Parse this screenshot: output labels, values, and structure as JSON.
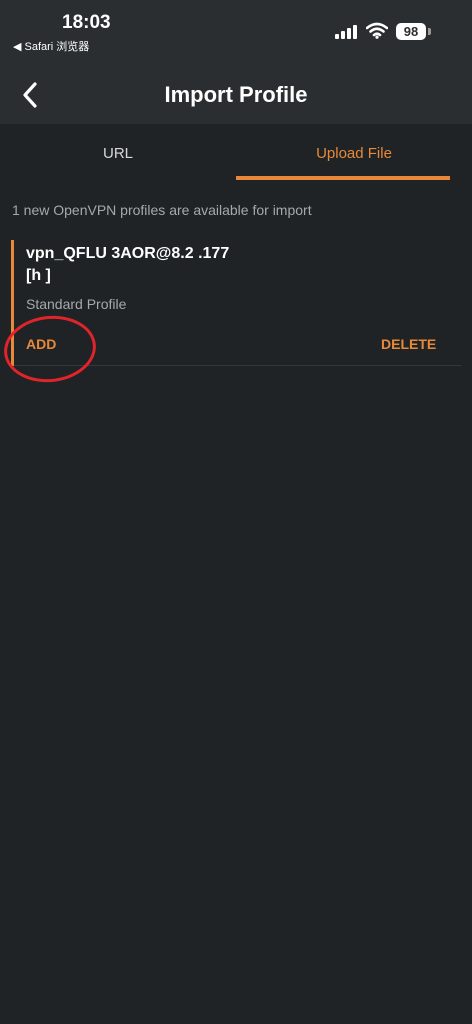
{
  "status_bar": {
    "time": "18:03",
    "back_app": "◀ Safari 浏览器",
    "battery": "98",
    "icons": [
      "signal-icon",
      "wifi-icon",
      "battery-icon"
    ]
  },
  "header": {
    "title": "Import Profile",
    "back_icon": "chevron-left-icon"
  },
  "tabs": [
    {
      "label": "URL",
      "active": false
    },
    {
      "label": "Upload File",
      "active": true
    }
  ],
  "info_text": "1 new OpenVPN profiles are available for import",
  "profile": {
    "name_line1": "vpn_QFLU   3AOR@8.2     .177",
    "name_line2": "[h               ]",
    "type": "Standard Profile",
    "add_label": "ADD",
    "delete_label": "DELETE"
  },
  "colors": {
    "accent": "#e8893a",
    "background": "#1f2326",
    "header_bg": "#2a2e31",
    "annotation": "#e0242a"
  }
}
